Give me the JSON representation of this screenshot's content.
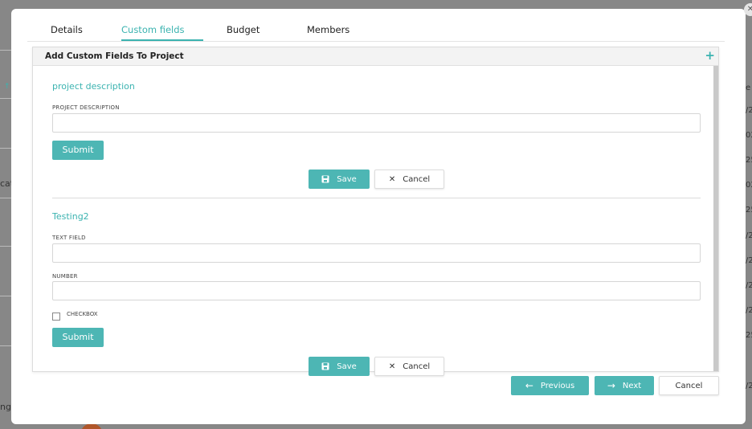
{
  "background": {
    "fragments": [
      "cat",
      "ng"
    ],
    "right_numbers": [
      "e",
      "/2",
      "02",
      "25",
      "02",
      "25",
      "/2",
      "/2",
      "/2",
      "/2",
      "25",
      "/2"
    ],
    "sort_arrow": "↑"
  },
  "tabs": [
    {
      "label": "Details"
    },
    {
      "label": "Custom fields"
    },
    {
      "label": "Budget"
    },
    {
      "label": "Members"
    }
  ],
  "panel": {
    "title": "Add Custom Fields To Project"
  },
  "section1": {
    "title": "project description",
    "field_label": "PROJECT DESCRIPTION",
    "field_value": "",
    "submit_label": "Submit",
    "save_label": "Save",
    "cancel_label": "Cancel"
  },
  "section2": {
    "title": "Testing2",
    "text_label": "TEXT FIELD",
    "text_value": "",
    "number_label": "NUMBER",
    "number_value": "",
    "checkbox_label": "CHECKBOX",
    "submit_label": "Submit",
    "save_label": "Save",
    "cancel_label": "Cancel"
  },
  "footer": {
    "previous_label": "Previous",
    "next_label": "Next",
    "cancel_label": "Cancel"
  },
  "colors": {
    "accent": "#4db6b4"
  }
}
